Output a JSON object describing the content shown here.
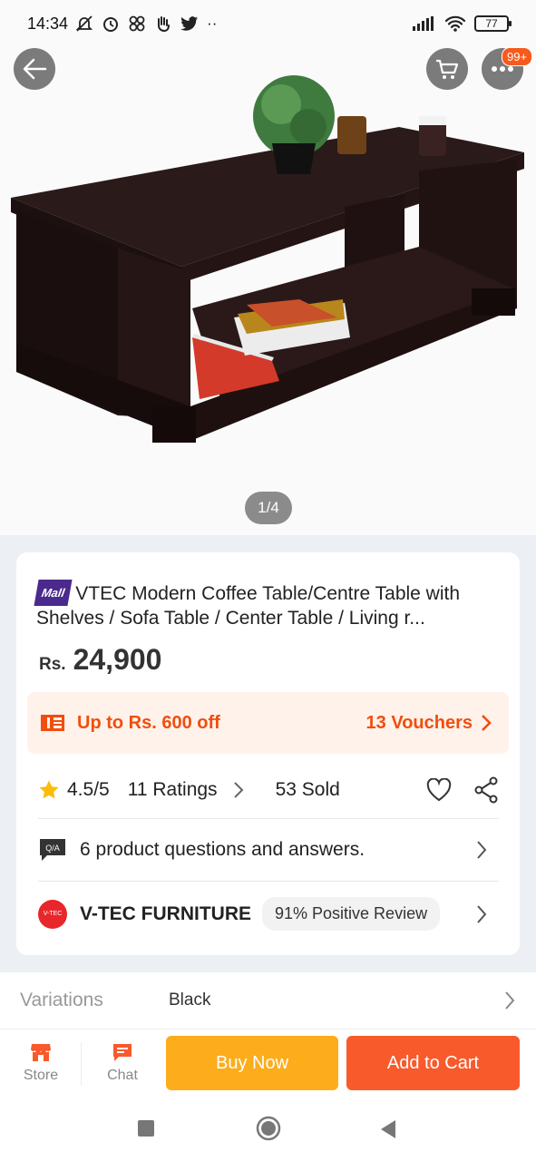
{
  "status_bar": {
    "time": "14:34",
    "battery": "77"
  },
  "gallery": {
    "page_indicator": "1/4",
    "notification_badge": "99+"
  },
  "product": {
    "mall_tag": "Mall",
    "title": "VTEC Modern Coffee Table/Centre Table with Shelves / Sofa Table / Center Table / Living r...",
    "currency": "Rs.",
    "price": "24,900"
  },
  "voucher": {
    "offer_text": "Up to Rs. 600 off",
    "vouchers_link": "13 Vouchers"
  },
  "rating": {
    "score": "4.5/5",
    "ratings_count": "11 Ratings",
    "sold": "53 Sold"
  },
  "qa": {
    "icon_label": "Q/A",
    "text": "6 product questions and answers."
  },
  "seller": {
    "logo_text": "V-TEC",
    "name": "V-TEC FURNITURE",
    "positive_review": "91% Positive Review"
  },
  "variations": {
    "label": "Variations",
    "value": "Black"
  },
  "bottom_bar": {
    "store_label": "Store",
    "chat_label": "Chat",
    "buy_now_label": "Buy Now",
    "add_to_cart_label": "Add to Cart"
  },
  "colors": {
    "accent_orange": "#f85a2c",
    "buy_now_yellow": "#fdac1c",
    "voucher_text": "#f04e0e",
    "mall_purple": "#4a2a8c"
  }
}
